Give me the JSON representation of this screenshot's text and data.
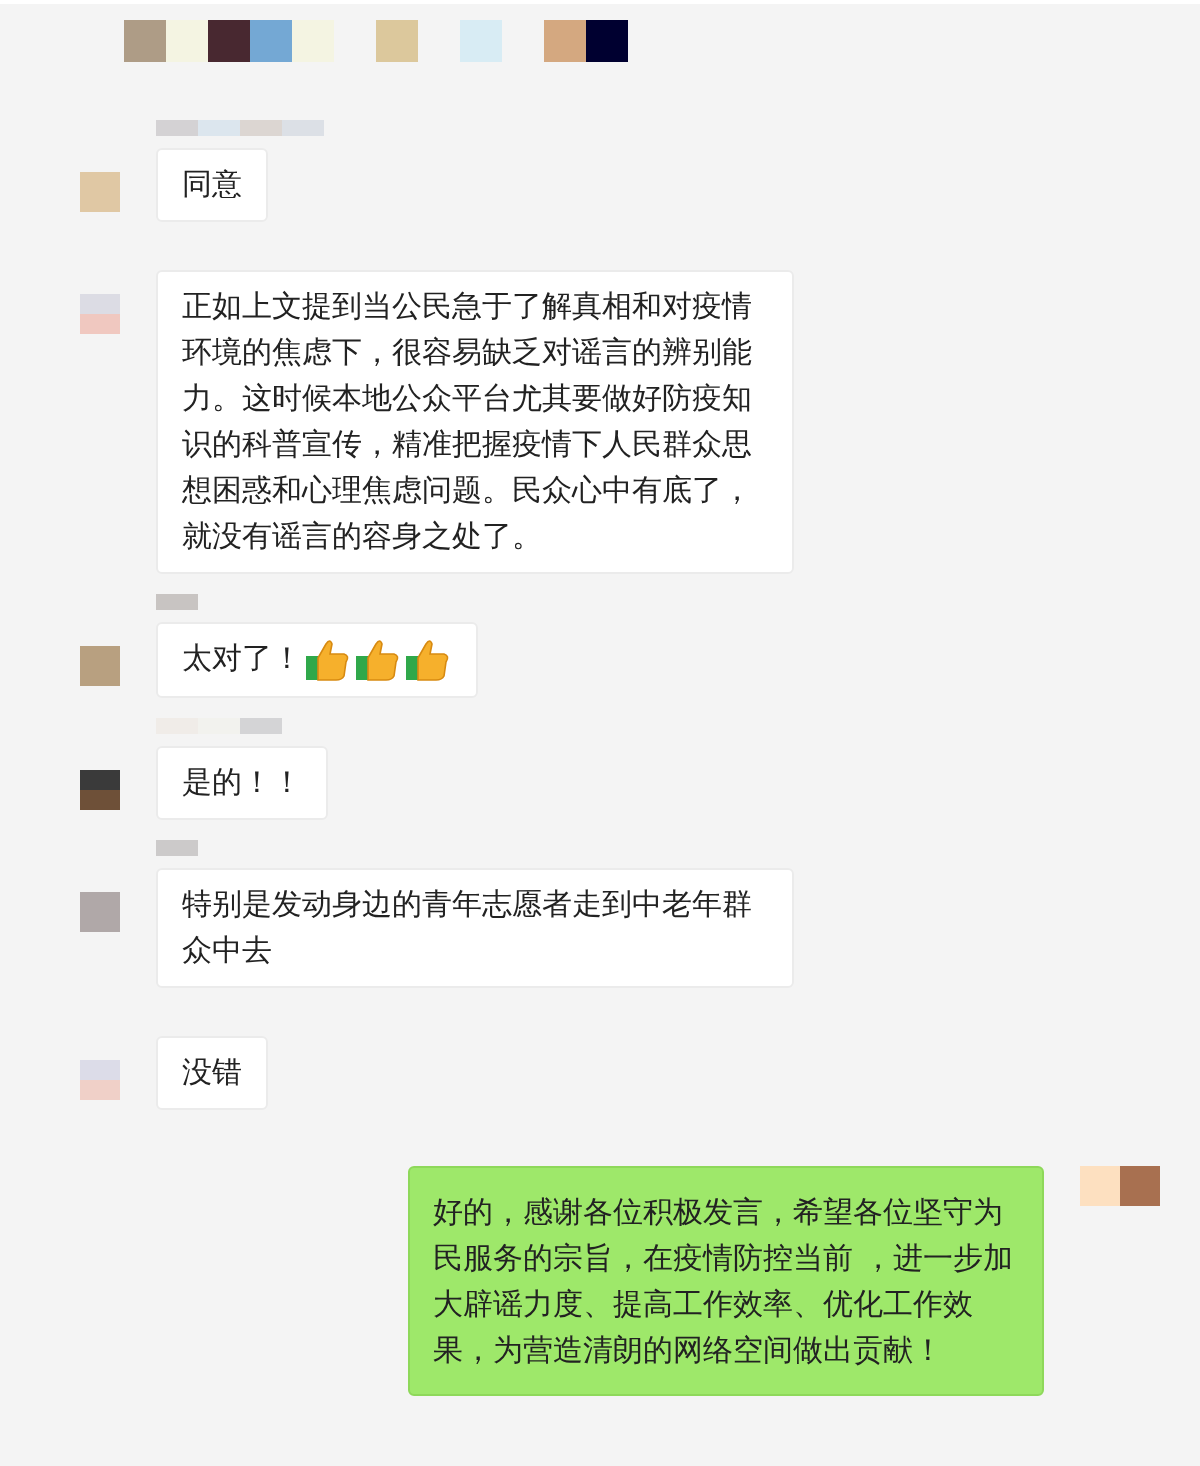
{
  "messages": [
    {
      "outgoing": false,
      "text": "同意"
    },
    {
      "outgoing": false,
      "text": "正如上文提到当公民急于了解真相和对疫情环境的焦虑下，很容易缺乏对谣言的辨别能力。这时候本地公众平台尤其要做好防疫知识的科普宣传，精准把握疫情下人民群众思想困惑和心理焦虑问题。民众心中有底了，就没有谣言的容身之处了。"
    },
    {
      "outgoing": false,
      "text": "太对了！"
    },
    {
      "outgoing": false,
      "text": "是的！！"
    },
    {
      "outgoing": false,
      "text": "特别是发动身边的青年志愿者走到中老年群众中去"
    },
    {
      "outgoing": false,
      "text": "没错"
    },
    {
      "outgoing": true,
      "text": "好的，感谢各位积极发言，希望各位坚守为民服务的宗旨，在疫情防控当前 ，进一步加大辟谣力度、提高工作效率、优化工作效果，为营造清朗的网络空间做出贡献！"
    }
  ]
}
